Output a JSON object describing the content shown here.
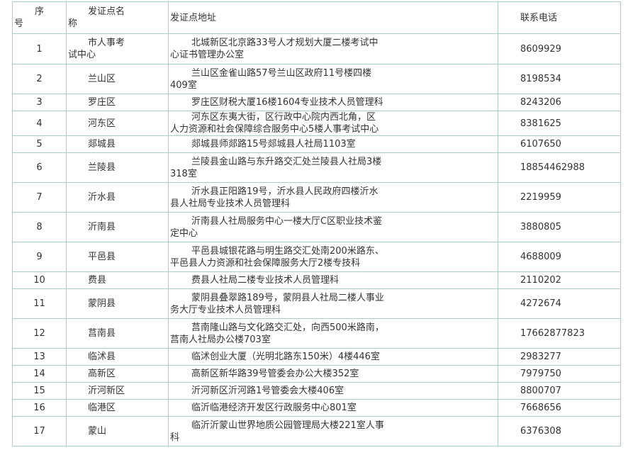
{
  "header": {
    "num_line1": "序",
    "num_line2": "号",
    "district_line1": "发证点名",
    "district_line2": "称",
    "address": "发证点地址",
    "phone": "联系电话"
  },
  "row1_district": {
    "line1": "市人事考",
    "line2": "试中心"
  },
  "rows": [
    {
      "num": "1",
      "district": "市人事考试中心",
      "addr1": "北城新区北京路33号人才规划大厦二楼考试中",
      "addr2": "心证书管理办公室",
      "phone": "8609929"
    },
    {
      "num": "2",
      "district": "兰山区",
      "addr1": "兰山区金雀山路57号兰山区政府11号楼四楼",
      "addr2": "409室",
      "phone": "8198534"
    },
    {
      "num": "3",
      "district": "罗庄区",
      "addr1": "罗庄区财税大厦16楼1604专业技术人员管理科",
      "addr2": "",
      "phone": "8243206"
    },
    {
      "num": "4",
      "district": "河东区",
      "addr1": "河东区东夷大街，区行政中心院内西北角，区",
      "addr2": "人力资源和社会保障综合服务中心5楼人事考试中心",
      "phone": "8381625"
    },
    {
      "num": "5",
      "district": "郯城县",
      "addr1": "郯城县师郯路15号郯城县人社局1103室",
      "addr2": "",
      "phone": "6107650"
    },
    {
      "num": "6",
      "district": "兰陵县",
      "addr1": "兰陵县金山路与东升路交汇处兰陵县人社局3楼",
      "addr2": "318室",
      "phone": "18854462988"
    },
    {
      "num": "7",
      "district": "沂水县",
      "addr1": "沂水县正阳路19号，沂水县人民政府四楼沂水",
      "addr2": "县人社局专业技术人员管理科",
      "phone": "2219959"
    },
    {
      "num": "8",
      "district": "沂南县",
      "addr1": "沂南县人社局服务中心一楼大厅C区职业技术鉴",
      "addr2": "定中心",
      "phone": "3880805"
    },
    {
      "num": "9",
      "district": "平邑县",
      "addr1": "平邑县城银花路与明生路交汇处南200米路东、",
      "addr2": "平邑县人力资源和社会保障服务大厅2楼专技科",
      "phone": "4688009"
    },
    {
      "num": "10",
      "district": "费县",
      "addr1": "费县人社局二楼专业技术人员管理科",
      "addr2": "",
      "phone": "2110202"
    },
    {
      "num": "11",
      "district": "蒙阴县",
      "addr1": "蒙阴县叠翠路189号，蒙阴县人社局二楼人事业",
      "addr2": "务大厅专业技术人员管理科",
      "phone": "4272674"
    },
    {
      "num": "12",
      "district": "莒南县",
      "addr1": "莒南隆山路与文化路交汇处，向西500米路南，",
      "addr2": "莒南人社局办公楼703室",
      "phone": "17662877823"
    },
    {
      "num": "13",
      "district": "临沭县",
      "addr1": "临沭创业大厦（光明北路东150米）4楼446室",
      "addr2": "",
      "phone": "2983277"
    },
    {
      "num": "14",
      "district": "高新区",
      "addr1": "高新区新华路39号管委会办公大楼352室",
      "addr2": "",
      "phone": "7979750"
    },
    {
      "num": "15",
      "district": "沂河新区",
      "addr1": "沂河新区沂河路1号管委会大楼406室",
      "addr2": "",
      "phone": "8800707"
    },
    {
      "num": "16",
      "district": "临港区",
      "addr1": "临沂临港经济开发区行政服务中心801室",
      "addr2": "",
      "phone": "7668656"
    },
    {
      "num": "17",
      "district": "蒙山",
      "addr1": "临沂沂蒙山世界地质公园管理局大楼221室人事",
      "addr2": "科",
      "phone": "6376308"
    }
  ]
}
